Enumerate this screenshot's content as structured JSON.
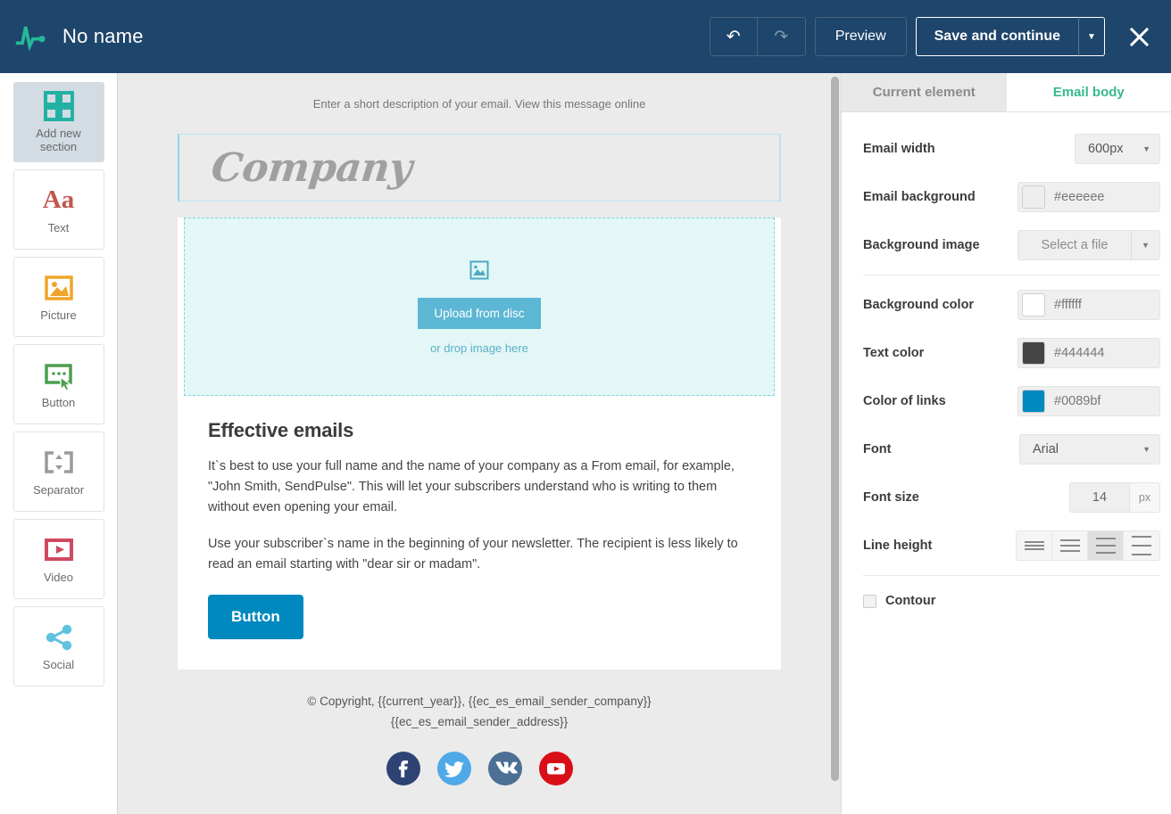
{
  "header": {
    "logo_icon": "pulse-logo-icon",
    "title": "No name",
    "undo_icon": "undo-arrow-icon",
    "redo_icon": "redo-arrow-icon",
    "preview_label": "Preview",
    "save_label": "Save and continue",
    "save_caret_icon": "chevron-down-icon",
    "close_icon": "close-icon",
    "bg_color": "#1e456b"
  },
  "sidebar": {
    "items": [
      {
        "label": "Add new\nsection",
        "label_line1": "Add new",
        "label_line2": "section",
        "icon": "grid-squares-icon",
        "active": true,
        "color": "#23b1a5"
      },
      {
        "label": "Text",
        "icon": "text-aa-icon",
        "active": false,
        "color": "#c0564f"
      },
      {
        "label": "Picture",
        "icon": "picture-icon",
        "active": false,
        "color": "#f0a52a"
      },
      {
        "label": "Button",
        "icon": "button-cursor-icon",
        "active": false,
        "color": "#4d9e4f"
      },
      {
        "label": "Separator",
        "icon": "separator-icon",
        "active": false,
        "color": "#9a9a9a"
      },
      {
        "label": "Video",
        "icon": "video-play-icon",
        "active": false,
        "color": "#cf4a60"
      },
      {
        "label": "Social",
        "icon": "share-nodes-icon",
        "active": false,
        "color": "#5ec3e0"
      }
    ]
  },
  "canvas": {
    "preheader": "Enter a short description of your email. View this message online",
    "logo_text": "Company",
    "dropzone": {
      "image_icon": "image-placeholder-icon",
      "upload_label": "Upload from disc",
      "drop_hint": "or drop image here"
    },
    "article": {
      "heading": "Effective emails",
      "paragraph1": "It`s best to use your full name and the name of your company as a From email, for example, \"John Smith, SendPulse\". This will let your subscribers understand who is writing to them without even opening your email.",
      "paragraph2": "Use your subscriber`s name in the beginning of your newsletter. The recipient is less likely to read an email starting with \"dear sir or madam\".",
      "button_label": "Button"
    },
    "footer": {
      "line1": "© Copyright, {{current_year}}, {{ec_es_email_sender_company}} ",
      "line2": "{{ec_es_email_sender_address}}",
      "social": [
        {
          "name": "facebook-icon",
          "color": "#2d4373",
          "glyph": "f"
        },
        {
          "name": "twitter-icon",
          "color": "#4fa8e8",
          "glyph": "t"
        },
        {
          "name": "vk-icon",
          "color": "#4c6f93",
          "glyph": "vk"
        },
        {
          "name": "youtube-icon",
          "color": "#d90f17",
          "glyph": "yt"
        }
      ]
    }
  },
  "panel": {
    "tabs": [
      {
        "label": "Current element",
        "active": false
      },
      {
        "label": "Email body",
        "active": true
      }
    ],
    "active_tab_color": "#37b88f",
    "fields": {
      "email_width": {
        "label": "Email width",
        "value": "600px"
      },
      "email_background": {
        "label": "Email background",
        "value": "#eeeeee",
        "swatch": "#eeeeee"
      },
      "background_image": {
        "label": "Background image",
        "value": "Select a file"
      },
      "background_color": {
        "label": "Background color",
        "value": "#ffffff",
        "swatch": "#ffffff"
      },
      "text_color": {
        "label": "Text color",
        "value": "#444444",
        "swatch": "#444444"
      },
      "color_of_links": {
        "label": "Color of links",
        "value": "#0089bf",
        "swatch": "#0089bf"
      },
      "font": {
        "label": "Font",
        "value": "Arial"
      },
      "font_size": {
        "label": "Font size",
        "value": "14",
        "unit": "px"
      },
      "line_height": {
        "label": "Line height",
        "selected_index": 2,
        "options": 4
      },
      "contour": {
        "label": "Contour",
        "checked": false
      }
    }
  }
}
